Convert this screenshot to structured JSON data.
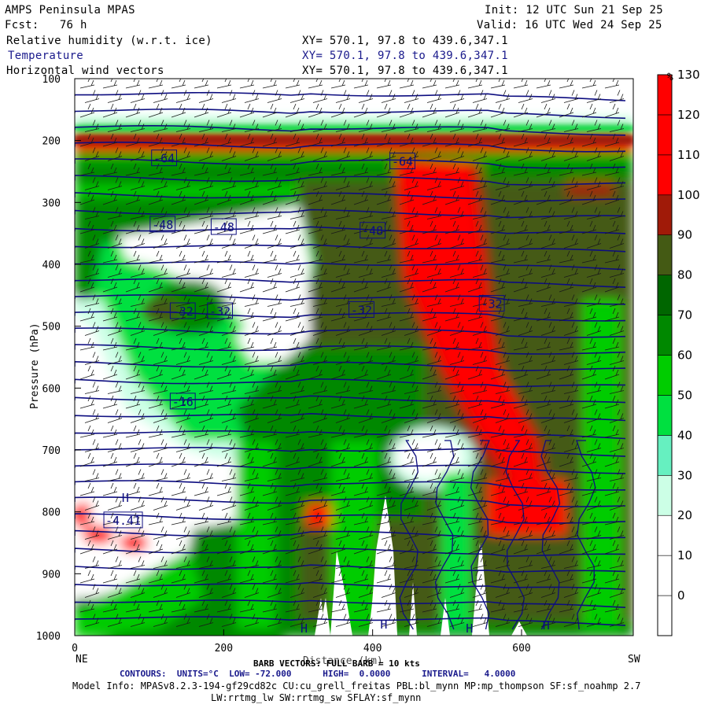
{
  "header": {
    "title": "AMPS Peninsula MPAS",
    "init": "Init: 12 UTC Sun 21 Sep 25",
    "fcst": "Fcst:   76 h",
    "valid": "Valid: 16 UTC Wed 24 Sep 25",
    "fields": [
      {
        "name": "Relative humidity (w.r.t. ice)",
        "xy": "XY= 570.1, 97.8 to 439.6,347.1"
      },
      {
        "name": "Temperature",
        "xy": "XY= 570.1, 97.8 to 439.6,347.1"
      },
      {
        "name": "Horizontal wind vectors",
        "xy": "XY= 570.1, 97.8 to 439.6,347.1"
      }
    ]
  },
  "colors": {
    "rh_bands": [
      "#ffffff",
      "#ffffff",
      "#ffffff",
      "#ffffff",
      "#ccffe6",
      "#66f0c0",
      "#00e040",
      "#00cc00",
      "#008800",
      "#006600",
      "#445a14",
      "#a01a08",
      "#ff0000"
    ],
    "temperature_contour": "#0d0d80"
  },
  "chart_data": {
    "type": "heatmap",
    "title": "Relative humidity (w.r.t. ice) / Temperature / Horizontal wind vectors",
    "xlabel": "Distance (km)",
    "ylabel": "Pressure (hPa)",
    "xlim": [
      0,
      750
    ],
    "ylim": [
      1000,
      100
    ],
    "x_ticks": [
      "0",
      "200",
      "400",
      "600"
    ],
    "x_tick_values": [
      0,
      200,
      400,
      600
    ],
    "x_end_labels": {
      "left": "NE",
      "right": "SW"
    },
    "y_ticks": [
      "100",
      "200",
      "300",
      "400",
      "500",
      "600",
      "700",
      "800",
      "900",
      "1000"
    ],
    "y_tick_values": [
      100,
      200,
      300,
      400,
      500,
      600,
      700,
      800,
      900,
      1000
    ],
    "colorbar": {
      "unit": "%",
      "boundaries": [
        -10,
        0,
        10,
        20,
        30,
        40,
        50,
        60,
        70,
        80,
        90,
        100,
        110,
        120,
        130
      ],
      "labels": [
        "130",
        "120",
        "110",
        "100",
        "90",
        "80",
        "70",
        "60",
        "50",
        "40",
        "30",
        "20",
        "10",
        "0"
      ]
    },
    "temperature_labels": [
      {
        "text": "-64",
        "x": 120,
        "p": 228
      },
      {
        "text": "-64",
        "x": 440,
        "p": 233
      },
      {
        "text": "-48",
        "x": 118,
        "p": 335
      },
      {
        "text": "-48",
        "x": 200,
        "p": 339
      },
      {
        "text": "-48",
        "x": 400,
        "p": 345
      },
      {
        "text": "-32",
        "x": 145,
        "p": 475
      },
      {
        "text": "-32",
        "x": 195,
        "p": 475
      },
      {
        "text": "-32",
        "x": 385,
        "p": 473
      },
      {
        "text": "-32",
        "x": 560,
        "p": 463
      },
      {
        "text": "-16",
        "x": 145,
        "p": 621
      },
      {
        "text": "-4.41",
        "x": 65,
        "p": 813
      }
    ],
    "high_markers": [
      {
        "text": "H",
        "x": 68,
        "p": 776
      },
      {
        "text": "H",
        "x": 308,
        "p": 987
      },
      {
        "text": "H",
        "x": 415,
        "p": 981
      },
      {
        "text": "H",
        "x": 530,
        "p": 987
      },
      {
        "text": "H",
        "x": 633,
        "p": 982
      }
    ],
    "contours": {
      "units": "°C",
      "low": -72.0,
      "high": 0.0,
      "interval": 4.0
    },
    "barb_reference_kts": 10
  },
  "footer": {
    "barb": "BARB VECTORS: FULL BARB = 10 kts",
    "xaxis_overlap": "Distance (km)",
    "contours": "CONTOURS:  UNITS=°C  LOW= -72.000      HIGH=  0.0000      INTERVAL=   4.0000",
    "model1": "Model Info: MPASv8.2.3-194-gf29cd82c CU:cu_grell_freitas PBL:bl_mynn MP:mp_thompson SF:sf_noahmp 2.7",
    "model2": "LW:rrtmg_lw SW:rrtmg_sw SFLAY:sf_mynn"
  }
}
